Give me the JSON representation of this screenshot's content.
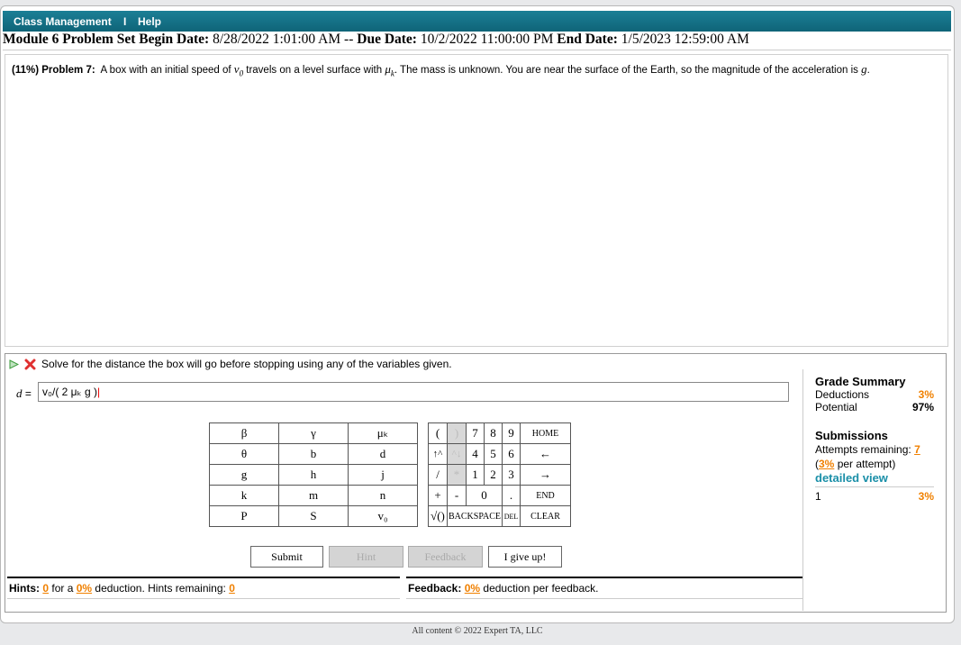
{
  "topbar": {
    "class_mgmt": "Class Management",
    "sep": "I",
    "help": "Help"
  },
  "dates": {
    "prefix": "Module 6 Problem Set",
    "begin_label": "Begin Date:",
    "begin": "8/28/2022 1:01:00 AM",
    "sep": "--",
    "due_label": "Due Date:",
    "due": "10/2/2022 11:00:00 PM",
    "end_label": "End Date:",
    "end": "1/5/2023 12:59:00 AM"
  },
  "problem": {
    "weight": "(11%)",
    "label": "Problem 7:",
    "text1": "A box with an initial speed of",
    "v0": "v",
    "v0_sub": "0",
    "text2": "travels on a level surface with",
    "mu": "μ",
    "mu_sub": "k",
    "text3": ". The mass is unknown. You are near the surface of the Earth, so the magnitude of the acceleration is",
    "g": "g",
    "end": "."
  },
  "part": {
    "instruction": "Solve for the distance the box will go before stopping using any of the variables given.",
    "answer_label": "d =",
    "answer_value": "v₀/( 2 μₖ g )"
  },
  "keypad": {
    "vars": [
      [
        "β",
        "γ",
        "μₖ"
      ],
      [
        "θ",
        "b",
        "d"
      ],
      [
        "g",
        "h",
        "j"
      ],
      [
        "k",
        "m",
        "n"
      ],
      [
        "P",
        "S",
        "v₀"
      ]
    ],
    "ops": {
      "lparen": "(",
      "rparen": ")",
      "up": "↑^",
      "down": "^↓",
      "slash": "/",
      "star": "*",
      "plus": "+",
      "minus": "-",
      "sqrt": "√()",
      "n7": "7",
      "n8": "8",
      "n9": "9",
      "n4": "4",
      "n5": "5",
      "n6": "6",
      "n1": "1",
      "n2": "2",
      "n3": "3",
      "n0": "0",
      "dot": ".",
      "home": "HOME",
      "left": "←",
      "right": "→",
      "end": "END",
      "clear": "CLEAR",
      "backspace": "BACKSPACE",
      "del": "DEL"
    }
  },
  "buttons": {
    "submit": "Submit",
    "hint": "Hint",
    "feedback": "Feedback",
    "giveup": "I give up!"
  },
  "hints": {
    "label": "Hints:",
    "count": "0",
    "for_a": "for a",
    "pct": "0%",
    "deduction": "deduction. Hints remaining:",
    "remaining": "0"
  },
  "feedback": {
    "label": "Feedback:",
    "pct": "0%",
    "text": "deduction per feedback."
  },
  "grade": {
    "title": "Grade Summary",
    "deductions_label": "Deductions",
    "deductions": "3%",
    "potential_label": "Potential",
    "potential": "97%",
    "submissions_title": "Submissions",
    "attempts_label": "Attempts remaining:",
    "attempts": "7",
    "per_pre": "(",
    "per_pct": "3%",
    "per_post": "per attempt)",
    "detailed": "detailed view",
    "sub_num": "1",
    "sub_pct": "3%"
  },
  "footer": "All content © 2022 Expert TA, LLC",
  "colors": {
    "topbar": "#0f6478",
    "accent": "#f08000",
    "link": "#1a8fa8"
  }
}
